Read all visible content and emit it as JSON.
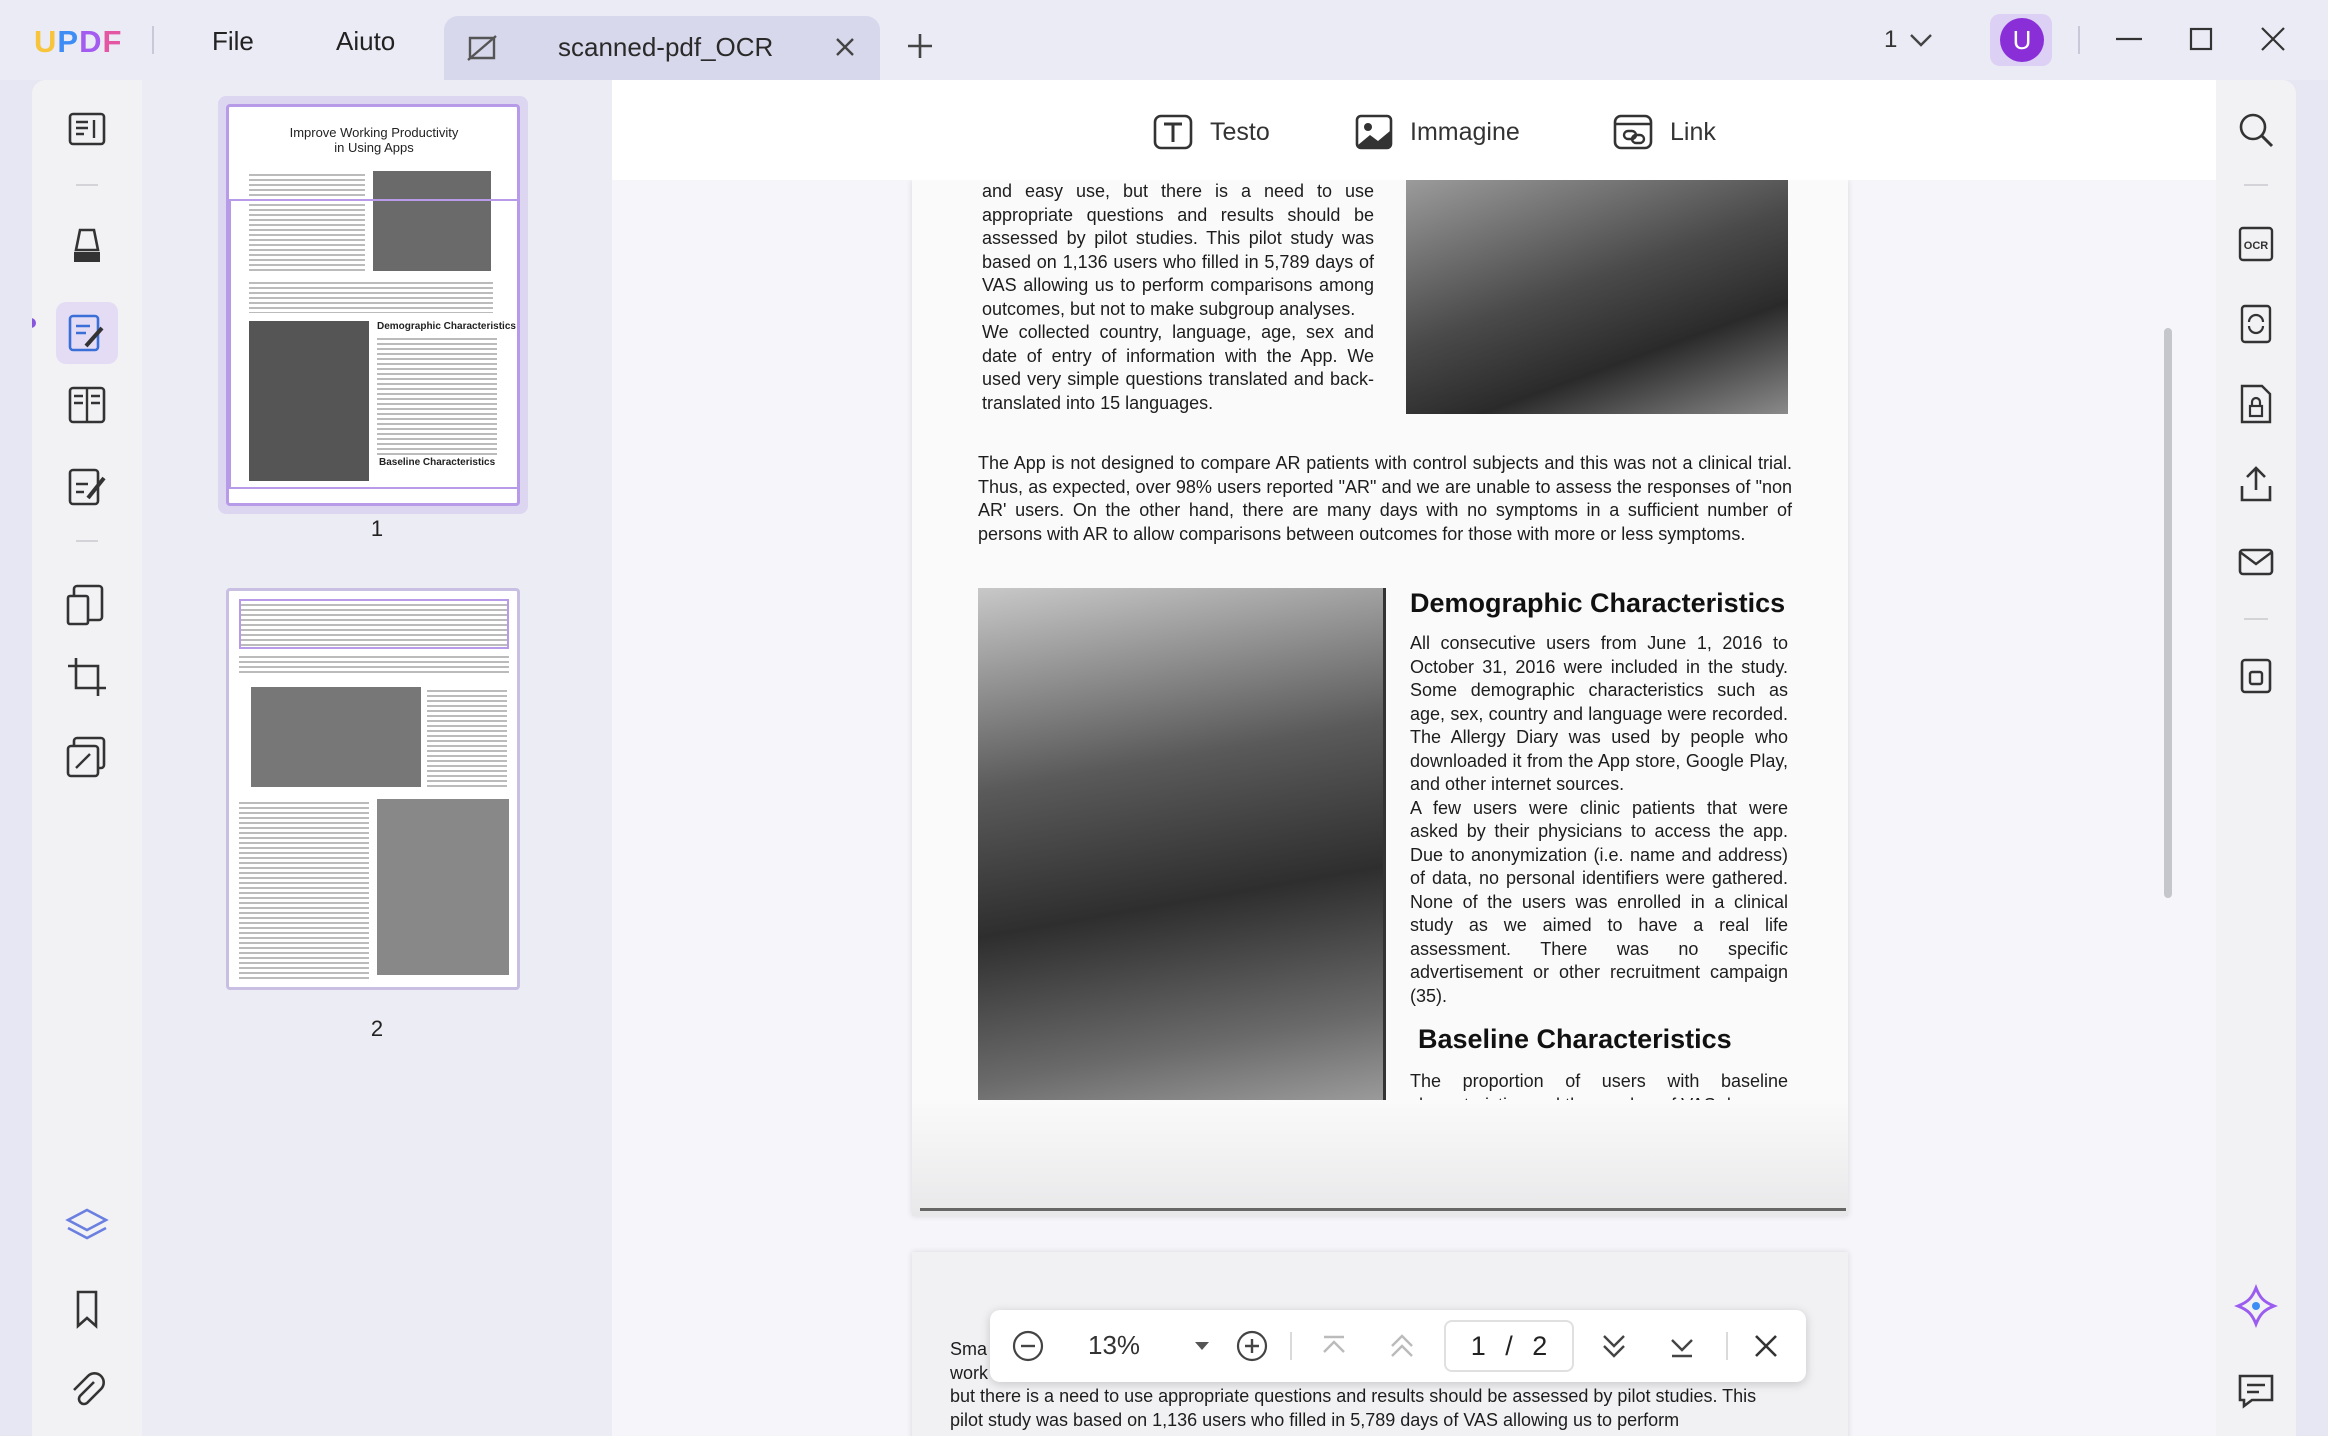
{
  "app": {
    "logo": {
      "u": "U",
      "p": "P",
      "d": "D",
      "f": "F"
    },
    "menu": {
      "file": "File",
      "help": "Aiuto"
    },
    "tab_title": "scanned-pdf_OCR",
    "page_selector": "1",
    "avatar_initial": "U"
  },
  "toolbar": {
    "text": "Testo",
    "image": "Immagine",
    "link": "Link"
  },
  "thumbnails": [
    {
      "label": "1"
    },
    {
      "label": "2"
    }
  ],
  "thumbnail_texts": {
    "t1_title1": "Improve Working Productivity",
    "t1_title2": "in Using Apps",
    "t1_h1": "Demographic Characteristics",
    "t1_h2": "Baseline Characteristics"
  },
  "document": {
    "p1_col_text": "and easy use, but there is a need to use appropriate questions and results should be assessed by pilot studies. This pilot study was based on 1,136 users who filled in 5,789 days of VAS allowing us to perform comparisons among outcomes, but not to make subgroup analyses.",
    "p1_col_text2": "We collected country, language, age, sex and date of entry of information with the App. We used very simple questions translated and back-translated into 15 languages.",
    "p1_para": "The App is not designed to compare AR patients with control subjects and this was not a clinical trial. Thus, as expected, over 98% users reported \"AR\" and we are unable to assess the responses of \"non AR' users. On the other hand, there are many days with no symptoms in a sufficient number of persons with AR to allow comparisons between outcomes for those with more or less symptoms.",
    "demo_title": "Demographic Characteristics",
    "demo_text1": "All consecutive users from June 1, 2016 to October 31, 2016 were included in the study. Some demographic characteristics such as age, sex, country and language were recorded. The Allergy Diary was used by people who downloaded it from the App store, Google Play, and other internet sources.",
    "demo_text2": "A few users were clinic patients that were asked by their physicians to access the app. Due to anonymization (i.e. name and address) of data, no personal identifiers were gathered. None of the users was enrolled in a clinical study as we aimed to have a real life assessment. There was no specific advertisement or other recruitment campaign (35).",
    "baseline_title": "Baseline Characteristics",
    "baseline_text": "The proportion of users with baseline characteristics and the number of VAS days",
    "p2_line1": "Sma",
    "p2_line2": "work",
    "p2_line3": "but there is a need to use appropriate questions and results should be assessed by pilot studies. This",
    "p2_line4": "pilot study was based on 1,136 users who filled in 5,789 days of VAS allowing us to perform"
  },
  "zoombar": {
    "zoom": "13%",
    "current_page": "1",
    "separator": "/",
    "total_pages": "2"
  },
  "colors": {
    "accent": "#8a2fd8",
    "thumb_border": "#b79ae8",
    "background": "#e6e7f3"
  }
}
